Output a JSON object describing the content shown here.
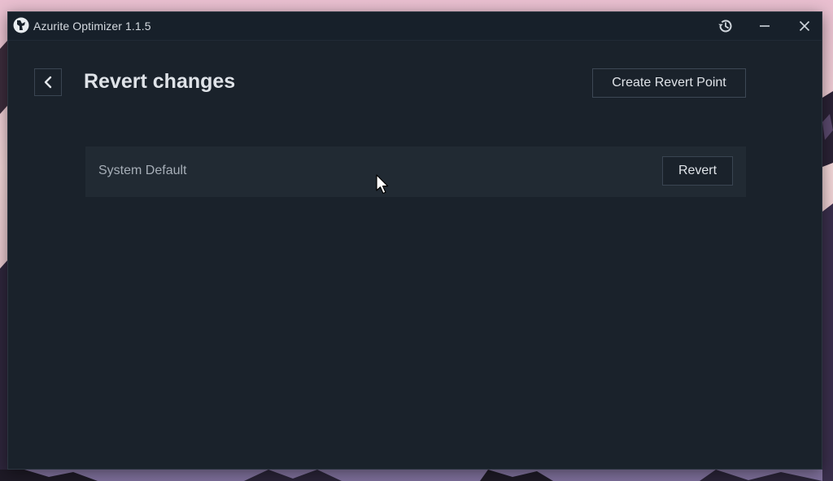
{
  "window": {
    "title": "Azurite Optimizer 1.1.5",
    "icons": {
      "app": "azurite-logo-icon",
      "history": "history-icon",
      "minimize": "minimize-icon",
      "close": "close-icon"
    }
  },
  "header": {
    "back_icon": "chevron-left-icon",
    "title": "Revert changes",
    "create_button_label": "Create Revert Point"
  },
  "revert_points": [
    {
      "name": "System Default",
      "action_label": "Revert"
    }
  ],
  "colors": {
    "window_background": "#1a222b",
    "titlebar": "#17202a",
    "row_background": "#212a33",
    "border": "#3a4552",
    "text_primary": "#dfe3e8",
    "text_secondary": "#a6aeb7"
  }
}
